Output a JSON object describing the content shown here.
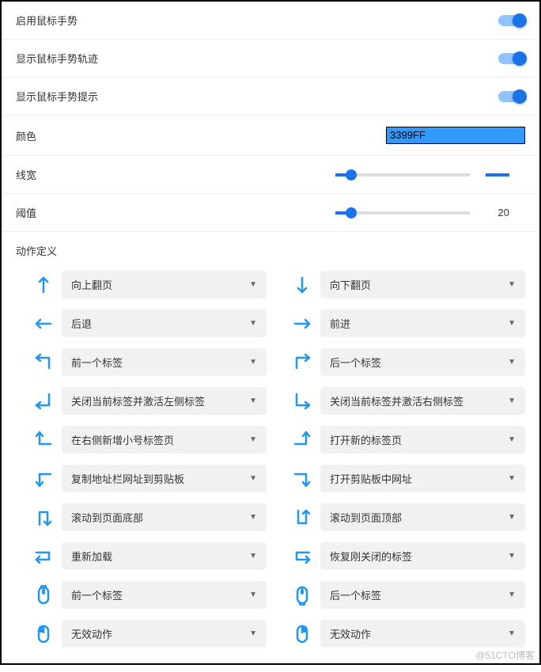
{
  "toggles": [
    {
      "label": "启用鼠标手势",
      "on": true
    },
    {
      "label": "显示鼠标手势轨迹",
      "on": true
    },
    {
      "label": "显示鼠标手势提示",
      "on": true
    }
  ],
  "color": {
    "label": "颜色",
    "value": "3399FF",
    "hex": "#3399FF"
  },
  "lineWidth": {
    "label": "线宽",
    "position": 12
  },
  "threshold": {
    "label": "阈值",
    "position": 12,
    "value": "20"
  },
  "actionsTitle": "动作定义",
  "actions": [
    {
      "icon": "arrow-up",
      "label": "向上翻页"
    },
    {
      "icon": "arrow-down",
      "label": "向下翻页"
    },
    {
      "icon": "arrow-left",
      "label": "后退"
    },
    {
      "icon": "arrow-right",
      "label": "前进"
    },
    {
      "icon": "up-left",
      "label": "前一个标签"
    },
    {
      "icon": "up-right",
      "label": "后一个标签"
    },
    {
      "icon": "down-left",
      "label": "关闭当前标签并激活左侧标签"
    },
    {
      "icon": "down-right",
      "label": "关闭当前标签并激活右侧标签"
    },
    {
      "icon": "left-up",
      "label": "在右侧新增小号标签页"
    },
    {
      "icon": "right-up",
      "label": "打开新的标签页"
    },
    {
      "icon": "left-down",
      "label": "复制地址栏网址到剪贴板"
    },
    {
      "icon": "right-down",
      "label": "打开剪贴板中网址"
    },
    {
      "icon": "up-down",
      "label": "滚动到页面底部"
    },
    {
      "icon": "down-up",
      "label": "滚动到页面顶部"
    },
    {
      "icon": "right-left",
      "label": "重新加载"
    },
    {
      "icon": "left-right",
      "label": "恢复刚关闭的标签"
    },
    {
      "icon": "mouse-up",
      "label": "前一个标签"
    },
    {
      "icon": "mouse-down",
      "label": "后一个标签"
    },
    {
      "icon": "mouse-left",
      "label": "无效动作"
    },
    {
      "icon": "mouse-right",
      "label": "无效动作"
    }
  ],
  "watermark": "@51CTO博客"
}
